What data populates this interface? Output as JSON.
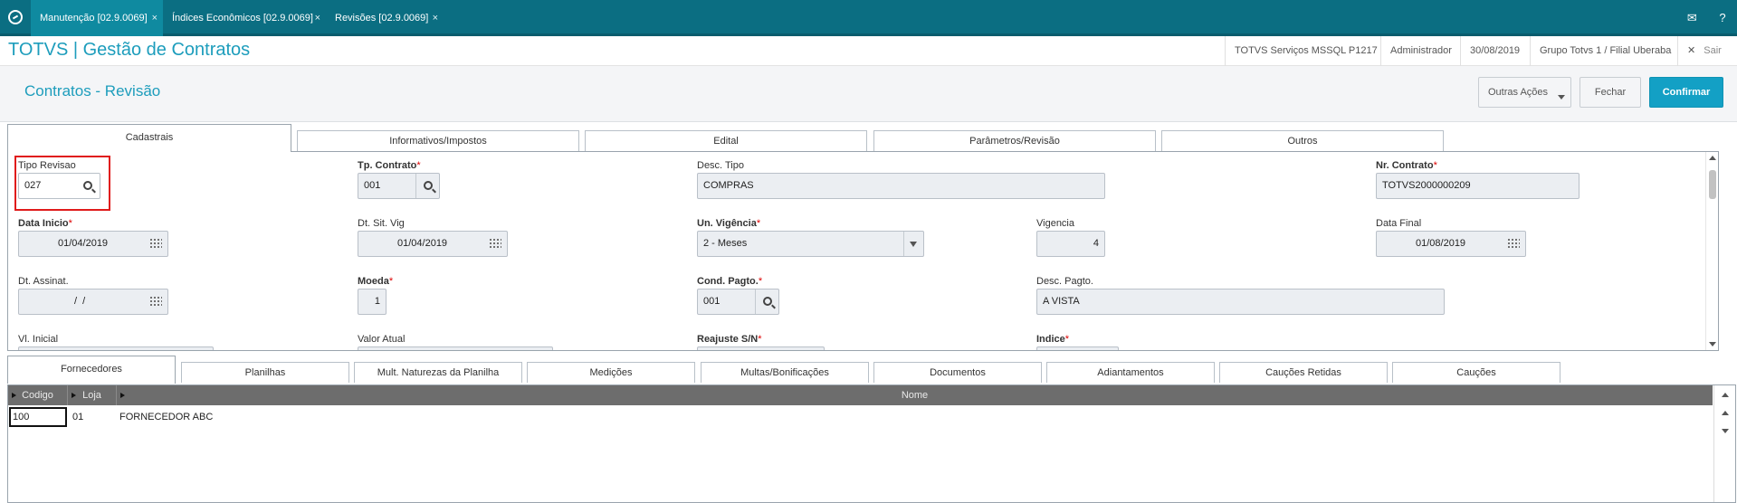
{
  "topbar": {
    "tabs": [
      {
        "label": "Manutenção [02.9.0069]",
        "close": "×",
        "active": true
      },
      {
        "label": "Índices Econômicos [02.9.0069]",
        "close": "×",
        "active": false
      },
      {
        "label": "Revisões [02.9.0069]",
        "close": "×",
        "active": false
      }
    ],
    "icons": {
      "mail": "✉",
      "help": "?"
    }
  },
  "header": {
    "app_title": "TOTVS | Gestão de Contratos",
    "server": "TOTVS Serviços MSSQL P1217",
    "user": "Administrador",
    "date": "30/08/2019",
    "company": "Grupo Totvs 1 / Filial Uberaba",
    "exit_icon": "✕",
    "exit_label": "Sair"
  },
  "subheader": {
    "title": "Contratos - Revisão",
    "actions": {
      "other": "Outras Ações",
      "close": "Fechar",
      "confirm": "Confirmar"
    }
  },
  "form_tabs": [
    "Cadastrais",
    "Informativos/Impostos",
    "Edital",
    "Parâmetros/Revisão",
    "Outros"
  ],
  "form": {
    "tipo_revisao": {
      "label": "Tipo Revisao",
      "value": "027"
    },
    "tp_contrato": {
      "label": "Tp. Contrato",
      "req": "*",
      "value": "001"
    },
    "desc_tipo": {
      "label": "Desc. Tipo",
      "value": "COMPRAS"
    },
    "nr_contrato": {
      "label": "Nr. Contrato",
      "req": "*",
      "value": "TOTVS2000000209"
    },
    "data_inicio": {
      "label": "Data Inicio",
      "req": "*",
      "value": "01/04/2019"
    },
    "dt_sit_vig": {
      "label": "Dt. Sit. Vig",
      "value": "01/04/2019"
    },
    "un_vigencia": {
      "label": "Un. Vigência",
      "req": "*",
      "value": "2 - Meses"
    },
    "vigencia": {
      "label": "Vigencia",
      "value": "4"
    },
    "data_final": {
      "label": "Data Final",
      "value": "01/08/2019"
    },
    "dt_assinat": {
      "label": "Dt. Assinat.",
      "value": "/  /"
    },
    "moeda": {
      "label": "Moeda",
      "req": "*",
      "value": "1"
    },
    "cond_pagto": {
      "label": "Cond. Pagto.",
      "req": "*",
      "value": "001"
    },
    "desc_pagto": {
      "label": "Desc. Pagto.",
      "value": "A VISTA"
    },
    "vl_inicial": {
      "label": "Vl. Inicial"
    },
    "valor_atual": {
      "label": "Valor Atual"
    },
    "reajuste": {
      "label": "Reajuste S/N",
      "req": "*"
    },
    "indice": {
      "label": "Indice",
      "req": "*"
    }
  },
  "grid_tabs": [
    "Fornecedores",
    "Planilhas",
    "Mult. Naturezas da Planilha",
    "Medições",
    "Multas/Bonificações",
    "Documentos",
    "Adiantamentos",
    "Cauções Retidas",
    "Cauções"
  ],
  "grid": {
    "columns": [
      "Codigo",
      "Loja",
      "Nome"
    ],
    "rows": [
      {
        "codigo": "100",
        "loja": "01",
        "nome": "FORNECEDOR ABC"
      }
    ]
  },
  "colors": {
    "brand": "#0b6e82",
    "accent": "#1d9dbc",
    "primary_button": "#13a0c5",
    "highlight": "#e01b1b",
    "required": "#d00"
  }
}
